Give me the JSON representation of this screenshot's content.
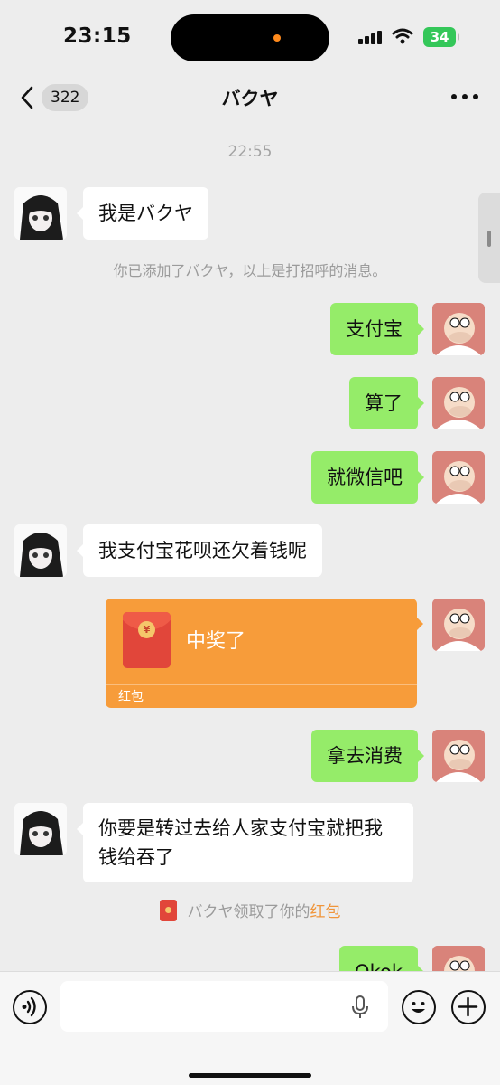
{
  "status_bar": {
    "time": "23:15",
    "battery": "34"
  },
  "nav": {
    "badge_count": "322",
    "title": "バクヤ"
  },
  "chat": {
    "timestamp": "22:55",
    "messages": [
      {
        "side": "in",
        "text": "我是バクヤ"
      },
      {
        "side": "out",
        "text": "支付宝"
      },
      {
        "side": "out",
        "text": "算了"
      },
      {
        "side": "out",
        "text": "就微信吧"
      },
      {
        "side": "in",
        "text": "我支付宝花呗还欠着钱呢"
      },
      {
        "side": "out",
        "text": "拿去消费"
      },
      {
        "side": "in",
        "text": "你要是转过去给人家支付宝就把我钱给吞了"
      },
      {
        "side": "out",
        "text": "Okok"
      }
    ],
    "system_added": "你已添加了バクヤ，以上是打招呼的消息。",
    "red_packet": {
      "title": "中奖了",
      "label": "红包",
      "currency_symbol": "¥"
    },
    "system_received_prefix": "バクヤ领取了你的",
    "system_received_link": "红包"
  },
  "icons": {
    "back": "chevron-left-icon",
    "more": "more-dots-icon",
    "voice": "voice-icon",
    "mic": "mic-icon",
    "emoji": "emoji-icon",
    "plus": "plus-icon"
  },
  "colors": {
    "background": "#ededed",
    "bubble_out": "#95ec69",
    "bubble_in": "#ffffff",
    "red_packet": "#f79c3a",
    "link": "#f0953a"
  }
}
